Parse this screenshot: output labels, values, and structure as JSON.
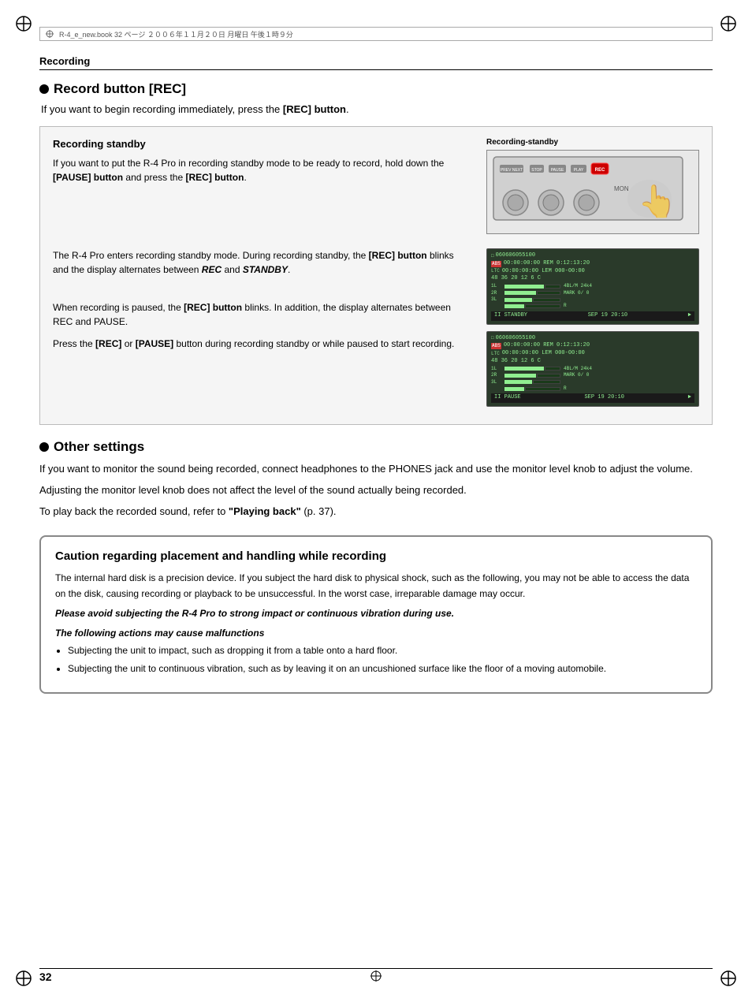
{
  "header": {
    "text": "R-4_e_new.book  32 ページ   ２００６年１１月２０日   月曜日   午後１時９分"
  },
  "section": {
    "title": "Recording"
  },
  "record_button_section": {
    "title": "Record button [REC]",
    "intro": "If you want to begin recording immediately, press the [REC] button."
  },
  "standby_box": {
    "title": "Recording standby",
    "diagram_label": "Recording-standby",
    "body1": "If you want to put the R-4 Pro in recording standby mode to be ready to record, hold down the [PAUSE] button and press the [REC] button.",
    "body2": "The R-4 Pro enters recording standby mode. During recording standby, the [REC] button blinks and the display alternates between REC and STANDBY.",
    "body3": "When recording is paused, the [REC] button blinks. In addition, the display alternates between REC and PAUSE.",
    "body4": "Press the [REC] or [PAUSE] button during recording standby or while paused to start recording.",
    "lcd1_line1": "060606055100",
    "lcd1_line2": "00:00:00:00  REM 0:12:13:20",
    "lcd1_line3": "00:00:00:00  LEM 000-00:00",
    "lcd1_line4": "48 36 20 12 6  C",
    "lcd1_status": "II STANDBY",
    "lcd1_time": "SEP 19 20:10",
    "lcd2_status": "II PAUSE",
    "lcd2_time": "SEP 19 20:10"
  },
  "other_settings": {
    "title": "Other settings",
    "text1": "If you want to monitor the sound being recorded, connect headphones to the PHONES jack and use the monitor level knob to adjust the volume.",
    "text2": "Adjusting the monitor level knob does not affect the level of the sound actually being recorded.",
    "text3": "To play back the recorded sound, refer to",
    "link_text": "\"Playing back\"",
    "link_ref": "(p. 37)."
  },
  "caution": {
    "title": "Caution regarding placement and handling while recording",
    "body1": "The internal hard disk is a precision device. If you subject the hard disk to physical shock, such as the following, you may not be able to access the data on the disk, causing recording or playback to be unsuccessful. In the worst case, irreparable damage may occur.",
    "body2_italic": "Please avoid subjecting the R-4 Pro to strong impact or continuous vibration during use.",
    "subtitle": "The following actions may cause malfunctions",
    "list": [
      "Subjecting the unit to impact, such as dropping it from a table onto a hard floor.",
      "Subjecting the unit to continuous vibration, such as by leaving it on an uncushioned surface like the floor of a moving automobile."
    ]
  },
  "footer": {
    "page": "32"
  },
  "buttons": {
    "prev": "PREV",
    "next": "NEXT",
    "stop": "STOP",
    "pause": "PAUSE",
    "play": "PLAY",
    "rec": "REC"
  }
}
